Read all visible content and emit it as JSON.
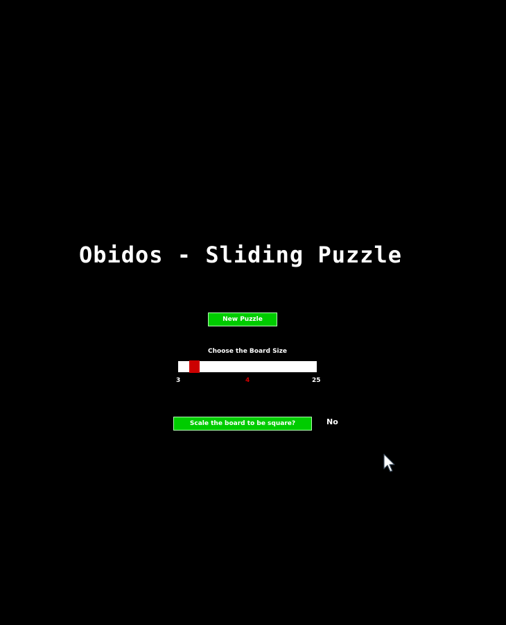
{
  "title": "Obidos - Sliding Puzzle",
  "new_puzzle_button": "New Puzzle",
  "board_size": {
    "label": "Choose the Board Size",
    "min": 3,
    "max": 25,
    "value": 4
  },
  "scale_button": "Scale the board to be square?",
  "scale_value": "No",
  "colors": {
    "background": "#000000",
    "button": "#00cc00",
    "slider_thumb": "#cc0000",
    "slider_track": "#ffffff",
    "text": "#ffffff"
  },
  "icons": {
    "cursor": "mouse-pointer-icon"
  }
}
